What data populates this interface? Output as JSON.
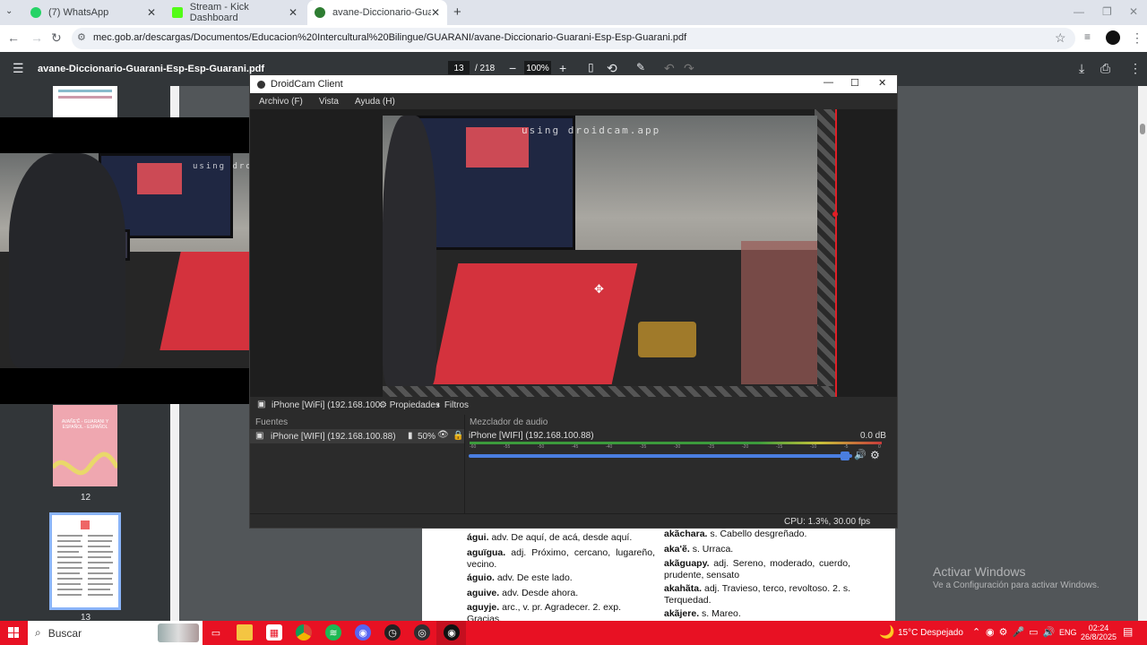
{
  "browser": {
    "tabs": [
      {
        "title": "(7) WhatsApp",
        "color": "#25d366"
      },
      {
        "title": "Stream - Kick Dashboard",
        "color": "#53fc18"
      },
      {
        "title": "avane-Diccionario-Guarani-Esp",
        "color": "#2e7d32"
      }
    ],
    "new_tab": "+",
    "url": "mec.gob.ar/descargas/Documentos/Educacion%20Intercultural%20Bilingue/GUARANI/avane-Diccionario-Guarani-Esp-Esp-Guarani.pdf"
  },
  "pdf": {
    "filename": "avane-Diccionario-Guarani-Esp-Esp-Guarani.pdf",
    "page_current": "13",
    "page_total": "/ 218",
    "zoom": "100%",
    "thumb_labels": [
      "12",
      "13"
    ],
    "thumb12_text": "AVAÑE'Ẽ - GUARANI Y ESPAÑOL - ESPAÑOL",
    "left_column": [
      {
        "head": "águi.",
        "body": "adv. De aquí, de acá, desde aquí."
      },
      {
        "head": "aguïgua.",
        "body": "adj. Próximo, cercano, lugareño, vecino."
      },
      {
        "head": "águio.",
        "body": "adv. De este lado."
      },
      {
        "head": "aguive.",
        "body": "adv. Desde ahora."
      },
      {
        "head": "aguyje.",
        "body": "arc., v. pr. Agradecer. 2. exp. Gracias."
      }
    ],
    "right_column": [
      {
        "head": "akãchara.",
        "body": "s. Cabello desgreñado."
      },
      {
        "head": "aka'ẽ.",
        "body": "s. Urraca."
      },
      {
        "head": "akãguapy.",
        "body": "adj. Sereno, moderado, cuerdo, prudente, sensato"
      },
      {
        "head": "akahãta.",
        "body": "adj. Travieso, terco, revoltoso. 2. s. Terquedad."
      },
      {
        "head": "akãjere.",
        "body": "s. Mareo."
      }
    ]
  },
  "droidcam": {
    "title": "DroidCam Client",
    "menu": [
      "Archivo (F)",
      "Vista",
      "Ayuda (H)"
    ],
    "watermark": "using droidcam.app",
    "source_tab": "iPhone [WiFi] (192.168.100.",
    "properties": "Propiedades",
    "filters": "Filtros",
    "sources_header": "Fuentes",
    "source_item": "iPhone [WIFI] (192.168.100.88)",
    "source_opacity": "50%",
    "mixer_header": "Mezclador de audio",
    "mixer_item": "iPhone [WIFI] (192.168.100.88)",
    "mixer_db": "0.0 dB",
    "meter_ticks": [
      "-60",
      "-55",
      "-50",
      "-45",
      "-40",
      "-35",
      "-30",
      "-25",
      "-20",
      "-15",
      "-10",
      "-5",
      "0"
    ],
    "volume_level": 1.0,
    "status": "CPU: 1.3%, 30.00 fps"
  },
  "windows": {
    "activate_title": "Activar Windows",
    "activate_sub": "Ve a Configuración para activar Windows.",
    "search": "Buscar",
    "weather": "15°C  Despejado",
    "lang": "ENG",
    "time": "02:24",
    "date": "26/8/2025"
  },
  "colors": {
    "taskbar": "#e81123",
    "accent": "#4a7ee0"
  }
}
